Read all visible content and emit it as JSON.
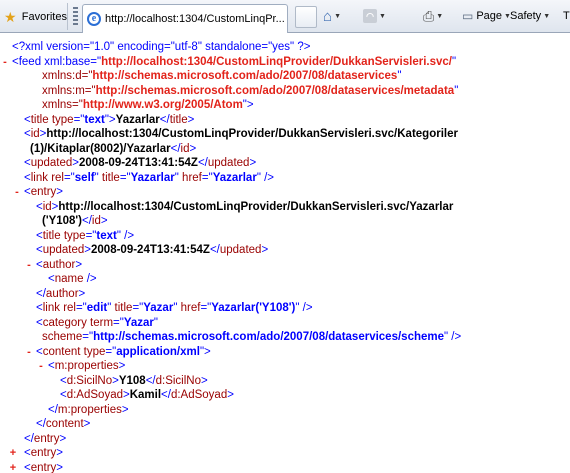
{
  "toolbar": {
    "favorites_label": "Favorites",
    "page_tab_title": "http://localhost:1304/CustomLinqPr...",
    "page_menu_label": "Page",
    "safety_menu_label": "Safety",
    "tools_menu_label": "T",
    "dropdown_arrow": "▼",
    "icons": {
      "favorites": "star-icon",
      "tab": "ie-icon",
      "home": "home-icon",
      "feeds": "rss-icon",
      "print": "printer-icon",
      "page": "page-icon"
    }
  },
  "xml": {
    "line01": "<?xml version=\"1.0\" encoding=\"utf-8\" standalone=\"yes\" ?>",
    "feed_open": "<feed xml:base=\"",
    "feed_base": "http://localhost:1304/CustomLinqProvider/DukkanServisleri.svc/",
    "xmlns_d_name": "xmlns:d=\"",
    "xmlns_d_val": "http://schemas.microsoft.com/ado/2007/08/dataservices",
    "xmlns_m_name": "xmlns:m=\"",
    "xmlns_m_val": "http://schemas.microsoft.com/ado/2007/08/dataservices/metadata",
    "xmlns_name": "xmlns=\"",
    "xmlns_val": "http://www.w3.org/2005/Atom",
    "title_type": "text",
    "title_text": "Yazarlar",
    "id_text_line1": "http://localhost:1304/CustomLinqProvider/DukkanServisleri.svc/Kategoriler",
    "id_text_line2": "(1)/Kitaplar(8002)/Yazarlar",
    "updated_text": "2008-09-24T13:41:54Z",
    "link_rel": "self",
    "link_title": "Yazarlar",
    "link_href": "Yazarlar",
    "entry_id_line1": "http://localhost:1304/CustomLinqProvider/DukkanServisleri.svc/Yazarlar",
    "entry_id_line2": "('Y108')",
    "entry_title_type": "text",
    "entry_updated": "2008-09-24T13:41:54Z",
    "author": "author",
    "name": "name",
    "entry_link_rel": "edit",
    "entry_link_title": "Yazar",
    "entry_link_href": "Yazarlar('Y108')",
    "category_term": "Yazar",
    "category_scheme": "http://schemas.microsoft.com/ado/2007/08/dataservices/scheme",
    "content_type": "application/xml",
    "sicilno_value": "Y108",
    "adsoyad_value": "Kamil",
    "toggle_minus": "-",
    "toggle_plus": "+"
  }
}
